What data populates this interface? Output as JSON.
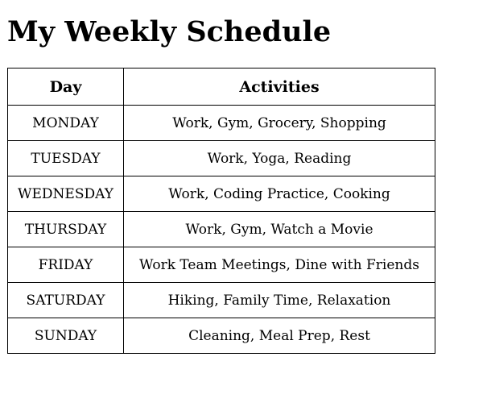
{
  "title": "My Weekly Schedule",
  "table": {
    "headers": {
      "day": "Day",
      "activities": "Activities"
    },
    "rows": [
      {
        "day": "MONDAY",
        "activities": "Work, Gym, Grocery, Shopping"
      },
      {
        "day": "TUESDAY",
        "activities": "Work, Yoga, Reading"
      },
      {
        "day": "WEDNESDAY",
        "activities": "Work, Coding Practice, Cooking"
      },
      {
        "day": "THURSDAY",
        "activities": "Work, Gym, Watch a Movie"
      },
      {
        "day": "FRIDAY",
        "activities": "Work Team Meetings, Dine with Friends"
      },
      {
        "day": "SATURDAY",
        "activities": "Hiking, Family Time, Relaxation"
      },
      {
        "day": "SUNDAY",
        "activities": "Cleaning, Meal Prep, Rest"
      }
    ]
  }
}
